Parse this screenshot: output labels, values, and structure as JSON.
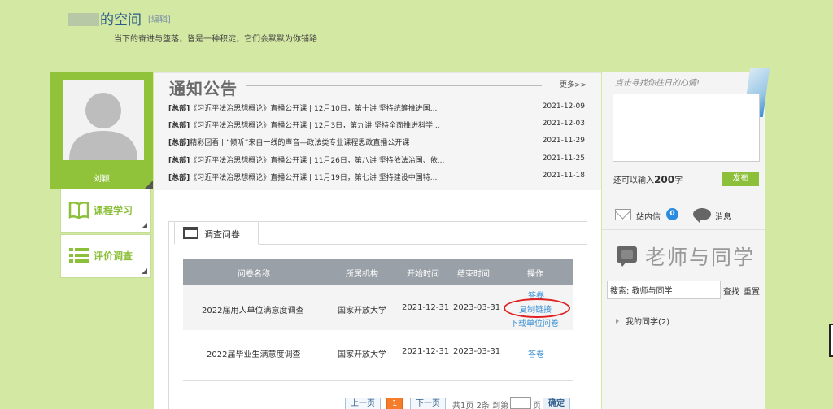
{
  "header": {
    "title": "的空间",
    "edit_label": "[编辑]",
    "motto": "当下的奋进与堕落，皆是一种积淀，它们会默默为你铺路"
  },
  "profile": {
    "name": "刘颖"
  },
  "nav": {
    "course": "课程学习",
    "evaluation": "评价调查"
  },
  "notice": {
    "title": "通知公告",
    "more": "更多>>",
    "items": [
      {
        "tag": "[总部]",
        "text": "《习近平法治思想概论》直播公开课 | 12月10日，第十讲 坚持统筹推进国...",
        "date": "2021-12-09"
      },
      {
        "tag": "[总部]",
        "text": "《习近平法治思想概论》直播公开课 | 12月3日，第九讲 坚持全面推进科学...",
        "date": "2021-12-03"
      },
      {
        "tag": "[总部]",
        "text": "精彩回看 | “倾听”来自一线的声音—政法类专业课程思政直播公开课",
        "date": "2021-11-29"
      },
      {
        "tag": "[总部]",
        "text": "《习近平法治思想概论》直播公开课 | 11月26日，第八讲 坚持依法治国、依...",
        "date": "2021-11-25"
      },
      {
        "tag": "[总部]",
        "text": "《习近平法治思想概论》直播公开课 | 11月19日，第七讲 坚持建设中国特...",
        "date": "2021-11-18"
      }
    ]
  },
  "survey": {
    "tab_label": "调查问卷",
    "columns": [
      "问卷名称",
      "所属机构",
      "开始时间",
      "结束时间",
      "操作"
    ],
    "rows": [
      {
        "name": "2022届用人单位满意度调查",
        "org": "国家开放大学",
        "start": "2021-12-31",
        "end": "2023-03-31",
        "ops": [
          "答卷",
          "复制链接",
          "下载单位问卷"
        ]
      },
      {
        "name": "2022届毕业生满意度调查",
        "org": "国家开放大学",
        "start": "2021-12-31",
        "end": "2023-03-31",
        "ops": [
          "答卷"
        ]
      }
    ]
  },
  "pager": {
    "prev": "上一页",
    "current": "1",
    "next": "下一页",
    "summary": "共1页 2条 到第",
    "page_unit": "页",
    "confirm": "确定"
  },
  "right": {
    "mood_hint": "点击寻找你往日的心情!",
    "char_count_prefix": "还可以输入",
    "char_count_value": "200",
    "char_count_suffix": "字",
    "publish": "发布",
    "mail_label": "站内信",
    "mail_count": "0",
    "msg_label": "消息",
    "teachers_title": "老师与同学",
    "search_value": "搜索: 教师与同学",
    "search_btn": "查找",
    "reset_btn": "重置",
    "classmates": "我的同学(2)"
  },
  "colors": {
    "background": "#d3e8a2",
    "accent_green": "#8cbf3a",
    "link_blue": "#3a8fd4",
    "highlight_red": "#e02020"
  }
}
